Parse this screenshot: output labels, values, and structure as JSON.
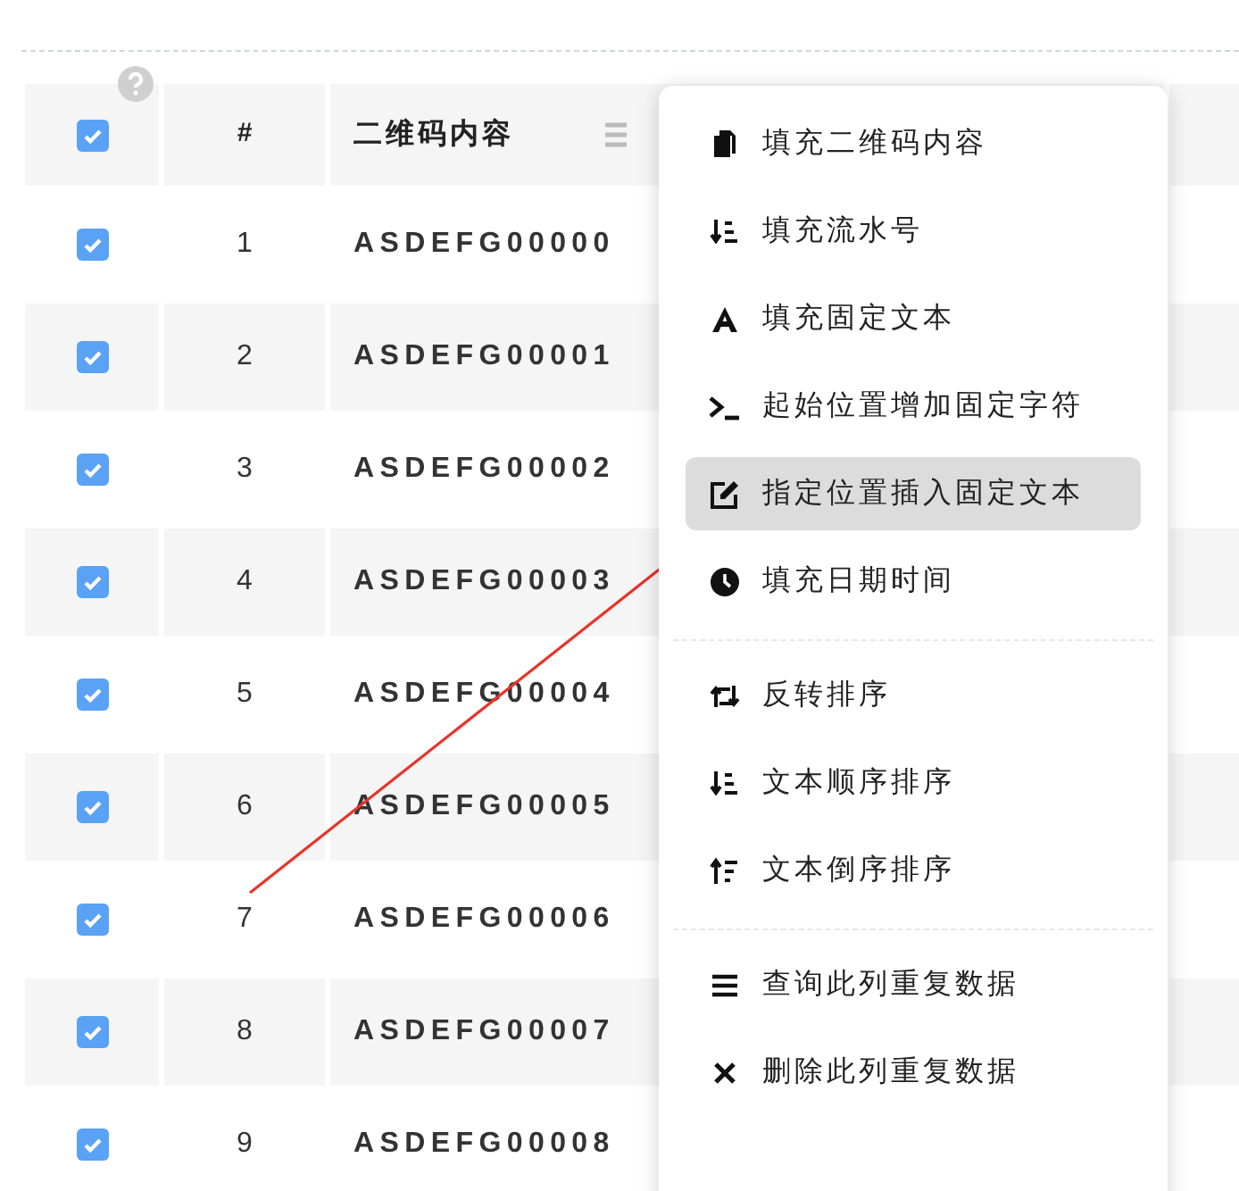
{
  "table": {
    "select_all": {
      "checked": true
    },
    "columns": [
      "#",
      "二维码内容"
    ],
    "rows": [
      {
        "checked": true,
        "index": "1",
        "code": "ASDEFG00000"
      },
      {
        "checked": true,
        "index": "2",
        "code": "ASDEFG00001"
      },
      {
        "checked": true,
        "index": "3",
        "code": "ASDEFG00002"
      },
      {
        "checked": true,
        "index": "4",
        "code": "ASDEFG00003"
      },
      {
        "checked": true,
        "index": "5",
        "code": "ASDEFG00004"
      },
      {
        "checked": true,
        "index": "6",
        "code": "ASDEFG00005"
      },
      {
        "checked": true,
        "index": "7",
        "code": "ASDEFG00006"
      },
      {
        "checked": true,
        "index": "8",
        "code": "ASDEFG00007"
      },
      {
        "checked": true,
        "index": "9",
        "code": "ASDEFG00008"
      }
    ]
  },
  "context_menu": {
    "groups": [
      [
        {
          "kind": "copy",
          "label": "填充二维码内容",
          "selected": false
        },
        {
          "kind": "sortdown",
          "label": "填充流水号",
          "selected": false
        },
        {
          "kind": "font",
          "label": "填充固定文本",
          "selected": false
        },
        {
          "kind": "terminal",
          "label": "起始位置增加固定字符",
          "selected": false
        },
        {
          "kind": "edit",
          "label": "指定位置插入固定文本",
          "selected": true
        },
        {
          "kind": "clock",
          "label": "填充日期时间",
          "selected": false
        }
      ],
      [
        {
          "kind": "repeat",
          "label": "反转排序",
          "selected": false
        },
        {
          "kind": "sortdown",
          "label": "文本顺序排序",
          "selected": false
        },
        {
          "kind": "sortup",
          "label": "文本倒序排序",
          "selected": false
        }
      ],
      [
        {
          "kind": "list",
          "label": "查询此列重复数据",
          "selected": false
        },
        {
          "kind": "delete",
          "label": "删除此列重复数据",
          "selected": false
        }
      ]
    ]
  }
}
